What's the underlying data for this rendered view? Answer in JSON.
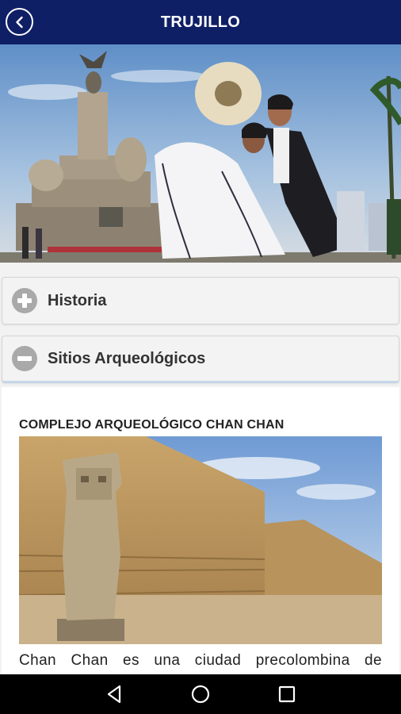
{
  "appbar": {
    "title": "TRUJILLO",
    "back_icon": "back-arrow-icon",
    "background": "#0f1f66"
  },
  "hero": {
    "description_icon": "hero-photo"
  },
  "accordion": {
    "sections": [
      {
        "label": "Historia",
        "state": "collapsed",
        "icon": "plus-circle-icon"
      },
      {
        "label": "Sitios Arqueológicos",
        "state": "expanded",
        "icon": "minus-circle-icon"
      }
    ],
    "expanded_panel": {
      "site_title": "COMPLEJO ARQUEOLÓGICO CHAN CHAN",
      "site_description": "Chan Chan es una ciudad precolombina de"
    }
  },
  "navbar": {
    "buttons": [
      "back-triangle-icon",
      "home-circle-icon",
      "recents-square-icon"
    ]
  },
  "colors": {
    "appbar": "#0f1f66",
    "accent_border": "#c6d6ea",
    "icon_gray": "#a9a9a9"
  }
}
